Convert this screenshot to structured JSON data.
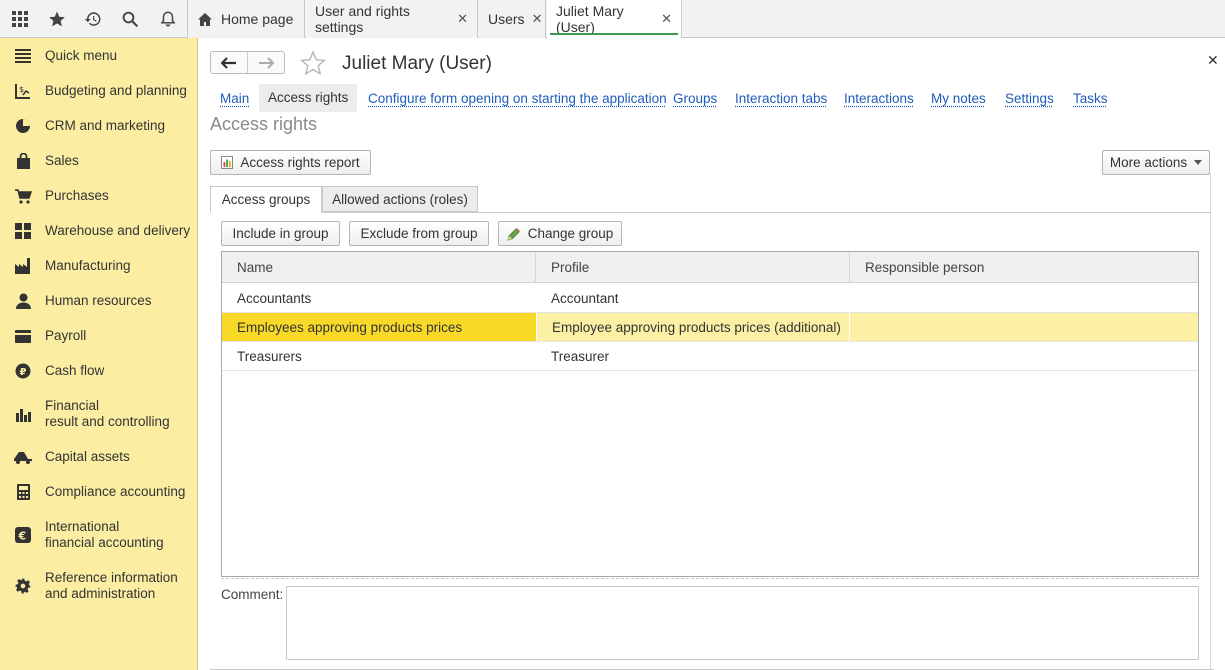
{
  "topbar": {
    "icons": [
      "apps-grid-icon",
      "star-icon",
      "history-icon",
      "search-icon",
      "bell-icon"
    ],
    "tabs": [
      {
        "label": "Home page",
        "icon": "home-icon",
        "closable": false
      },
      {
        "label": "User and rights settings",
        "closable": true
      },
      {
        "label": "Users",
        "closable": true
      },
      {
        "label": "Juliet Mary (User)",
        "closable": true,
        "active": true
      }
    ],
    "close_glyph": "✕"
  },
  "sidebar": {
    "items": [
      {
        "label": "Quick menu",
        "icon": "menu-lines-icon"
      },
      {
        "label": "Budgeting and planning",
        "icon": "budget-chart-icon"
      },
      {
        "label": "CRM and marketing",
        "icon": "pie-chart-icon"
      },
      {
        "label": "Sales",
        "icon": "shopping-bag-icon"
      },
      {
        "label": "Purchases",
        "icon": "cart-icon"
      },
      {
        "label": "Warehouse and delivery",
        "icon": "warehouse-icon"
      },
      {
        "label": "Manufacturing",
        "icon": "factory-icon"
      },
      {
        "label": "Human resources",
        "icon": "person-icon"
      },
      {
        "label": "Payroll",
        "icon": "wallet-icon"
      },
      {
        "label": "Cash flow",
        "icon": "ruble-coin-icon"
      },
      {
        "label": "Financial\nresult and controlling",
        "icon": "bar-chart-icon"
      },
      {
        "label": "Capital assets",
        "icon": "truck-icon"
      },
      {
        "label": "Compliance accounting",
        "icon": "calculator-icon"
      },
      {
        "label": "International\nfinancial accounting",
        "icon": "euro-icon"
      },
      {
        "label": "Reference information\nand administration",
        "icon": "gear-icon"
      }
    ]
  },
  "form": {
    "title": "Juliet Mary (User)",
    "close_glyph": "✕",
    "links": [
      {
        "label": "Main"
      },
      {
        "label": "Access rights",
        "active": true
      },
      {
        "label": "Configure form opening on starting the application"
      },
      {
        "label": "Groups"
      },
      {
        "label": "Interaction tabs"
      },
      {
        "label": "Interactions"
      },
      {
        "label": "My notes"
      },
      {
        "label": "Settings"
      },
      {
        "label": "Tasks"
      }
    ],
    "section_title": "Access rights",
    "report_button": "Access rights report",
    "more_actions": "More actions",
    "tabs": [
      {
        "label": "Access groups",
        "active": true
      },
      {
        "label": "Allowed actions (roles)"
      }
    ],
    "buttons": {
      "include": "Include in group",
      "exclude": "Exclude from group",
      "change": "Change group"
    },
    "table": {
      "columns": [
        "Name",
        "Profile",
        "Responsible person"
      ],
      "rows": [
        {
          "name": "Accountants",
          "profile": "Accountant",
          "responsible": ""
        },
        {
          "name": "Employees approving products prices",
          "profile": "Employee approving products prices (additional)",
          "responsible": "",
          "selected": true
        },
        {
          "name": "Treasurers",
          "profile": "Treasurer",
          "responsible": ""
        }
      ]
    },
    "comment_label": "Comment:",
    "comment_value": ""
  },
  "colors": {
    "sidebar_bg": "#fbeea3",
    "selected_row": "#fbf0a4",
    "selected_cell": "#f9d928",
    "link": "#1f5db8",
    "active_tab_underline": "#3a9a4e"
  }
}
